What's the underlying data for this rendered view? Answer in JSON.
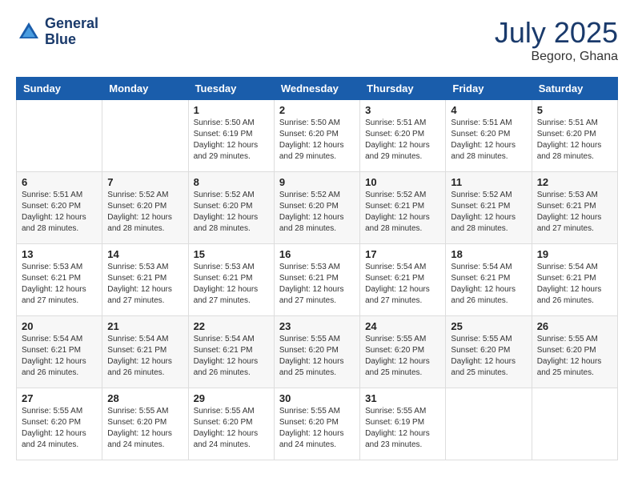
{
  "header": {
    "logo_line1": "General",
    "logo_line2": "Blue",
    "month": "July 2025",
    "location": "Begoro, Ghana"
  },
  "weekdays": [
    "Sunday",
    "Monday",
    "Tuesday",
    "Wednesday",
    "Thursday",
    "Friday",
    "Saturday"
  ],
  "weeks": [
    [
      {
        "day": "",
        "info": ""
      },
      {
        "day": "",
        "info": ""
      },
      {
        "day": "1",
        "info": "Sunrise: 5:50 AM\nSunset: 6:19 PM\nDaylight: 12 hours\nand 29 minutes."
      },
      {
        "day": "2",
        "info": "Sunrise: 5:50 AM\nSunset: 6:20 PM\nDaylight: 12 hours\nand 29 minutes."
      },
      {
        "day": "3",
        "info": "Sunrise: 5:51 AM\nSunset: 6:20 PM\nDaylight: 12 hours\nand 29 minutes."
      },
      {
        "day": "4",
        "info": "Sunrise: 5:51 AM\nSunset: 6:20 PM\nDaylight: 12 hours\nand 28 minutes."
      },
      {
        "day": "5",
        "info": "Sunrise: 5:51 AM\nSunset: 6:20 PM\nDaylight: 12 hours\nand 28 minutes."
      }
    ],
    [
      {
        "day": "6",
        "info": "Sunrise: 5:51 AM\nSunset: 6:20 PM\nDaylight: 12 hours\nand 28 minutes."
      },
      {
        "day": "7",
        "info": "Sunrise: 5:52 AM\nSunset: 6:20 PM\nDaylight: 12 hours\nand 28 minutes."
      },
      {
        "day": "8",
        "info": "Sunrise: 5:52 AM\nSunset: 6:20 PM\nDaylight: 12 hours\nand 28 minutes."
      },
      {
        "day": "9",
        "info": "Sunrise: 5:52 AM\nSunset: 6:20 PM\nDaylight: 12 hours\nand 28 minutes."
      },
      {
        "day": "10",
        "info": "Sunrise: 5:52 AM\nSunset: 6:21 PM\nDaylight: 12 hours\nand 28 minutes."
      },
      {
        "day": "11",
        "info": "Sunrise: 5:52 AM\nSunset: 6:21 PM\nDaylight: 12 hours\nand 28 minutes."
      },
      {
        "day": "12",
        "info": "Sunrise: 5:53 AM\nSunset: 6:21 PM\nDaylight: 12 hours\nand 27 minutes."
      }
    ],
    [
      {
        "day": "13",
        "info": "Sunrise: 5:53 AM\nSunset: 6:21 PM\nDaylight: 12 hours\nand 27 minutes."
      },
      {
        "day": "14",
        "info": "Sunrise: 5:53 AM\nSunset: 6:21 PM\nDaylight: 12 hours\nand 27 minutes."
      },
      {
        "day": "15",
        "info": "Sunrise: 5:53 AM\nSunset: 6:21 PM\nDaylight: 12 hours\nand 27 minutes."
      },
      {
        "day": "16",
        "info": "Sunrise: 5:53 AM\nSunset: 6:21 PM\nDaylight: 12 hours\nand 27 minutes."
      },
      {
        "day": "17",
        "info": "Sunrise: 5:54 AM\nSunset: 6:21 PM\nDaylight: 12 hours\nand 27 minutes."
      },
      {
        "day": "18",
        "info": "Sunrise: 5:54 AM\nSunset: 6:21 PM\nDaylight: 12 hours\nand 26 minutes."
      },
      {
        "day": "19",
        "info": "Sunrise: 5:54 AM\nSunset: 6:21 PM\nDaylight: 12 hours\nand 26 minutes."
      }
    ],
    [
      {
        "day": "20",
        "info": "Sunrise: 5:54 AM\nSunset: 6:21 PM\nDaylight: 12 hours\nand 26 minutes."
      },
      {
        "day": "21",
        "info": "Sunrise: 5:54 AM\nSunset: 6:21 PM\nDaylight: 12 hours\nand 26 minutes."
      },
      {
        "day": "22",
        "info": "Sunrise: 5:54 AM\nSunset: 6:21 PM\nDaylight: 12 hours\nand 26 minutes."
      },
      {
        "day": "23",
        "info": "Sunrise: 5:55 AM\nSunset: 6:20 PM\nDaylight: 12 hours\nand 25 minutes."
      },
      {
        "day": "24",
        "info": "Sunrise: 5:55 AM\nSunset: 6:20 PM\nDaylight: 12 hours\nand 25 minutes."
      },
      {
        "day": "25",
        "info": "Sunrise: 5:55 AM\nSunset: 6:20 PM\nDaylight: 12 hours\nand 25 minutes."
      },
      {
        "day": "26",
        "info": "Sunrise: 5:55 AM\nSunset: 6:20 PM\nDaylight: 12 hours\nand 25 minutes."
      }
    ],
    [
      {
        "day": "27",
        "info": "Sunrise: 5:55 AM\nSunset: 6:20 PM\nDaylight: 12 hours\nand 24 minutes."
      },
      {
        "day": "28",
        "info": "Sunrise: 5:55 AM\nSunset: 6:20 PM\nDaylight: 12 hours\nand 24 minutes."
      },
      {
        "day": "29",
        "info": "Sunrise: 5:55 AM\nSunset: 6:20 PM\nDaylight: 12 hours\nand 24 minutes."
      },
      {
        "day": "30",
        "info": "Sunrise: 5:55 AM\nSunset: 6:20 PM\nDaylight: 12 hours\nand 24 minutes."
      },
      {
        "day": "31",
        "info": "Sunrise: 5:55 AM\nSunset: 6:19 PM\nDaylight: 12 hours\nand 23 minutes."
      },
      {
        "day": "",
        "info": ""
      },
      {
        "day": "",
        "info": ""
      }
    ]
  ]
}
